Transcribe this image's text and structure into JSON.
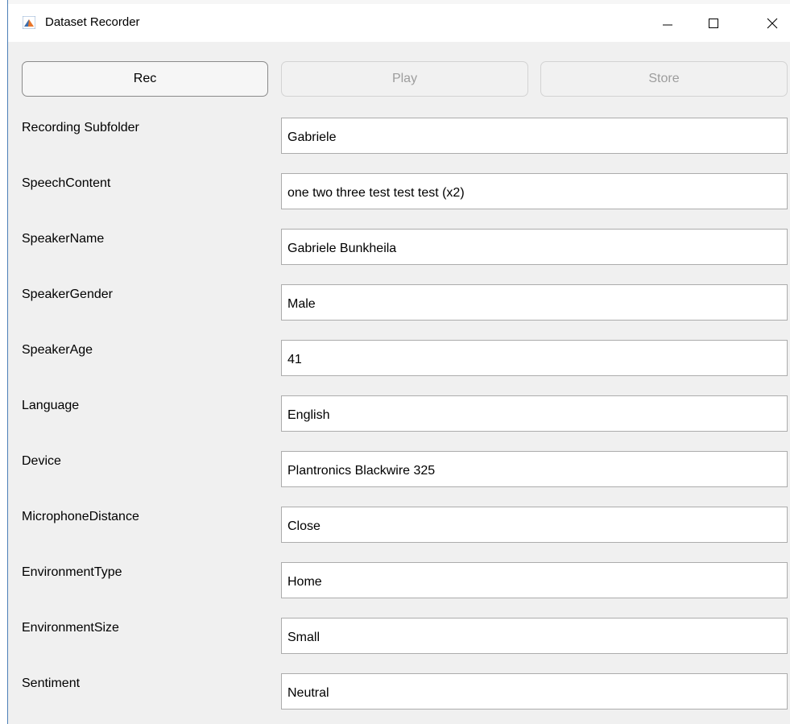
{
  "window": {
    "title": "Dataset Recorder",
    "controls": {
      "minimize": "—",
      "maximize": "☐",
      "close": "✕"
    }
  },
  "toolbar": {
    "rec_label": "Rec",
    "play_label": "Play",
    "store_label": "Store"
  },
  "fields": [
    {
      "label": "Recording Subfolder",
      "value": "Gabriele"
    },
    {
      "label": "SpeechContent",
      "value": "one two three test test test (x2)"
    },
    {
      "label": "SpeakerName",
      "value": "Gabriele Bunkheila"
    },
    {
      "label": "SpeakerGender",
      "value": "Male"
    },
    {
      "label": "SpeakerAge",
      "value": "41"
    },
    {
      "label": "Language",
      "value": "English"
    },
    {
      "label": "Device",
      "value": "Plantronics Blackwire 325"
    },
    {
      "label": "MicrophoneDistance",
      "value": "Close"
    },
    {
      "label": "EnvironmentType",
      "value": "Home"
    },
    {
      "label": "EnvironmentSize",
      "value": "Small"
    },
    {
      "label": "Sentiment",
      "value": "Neutral"
    }
  ]
}
